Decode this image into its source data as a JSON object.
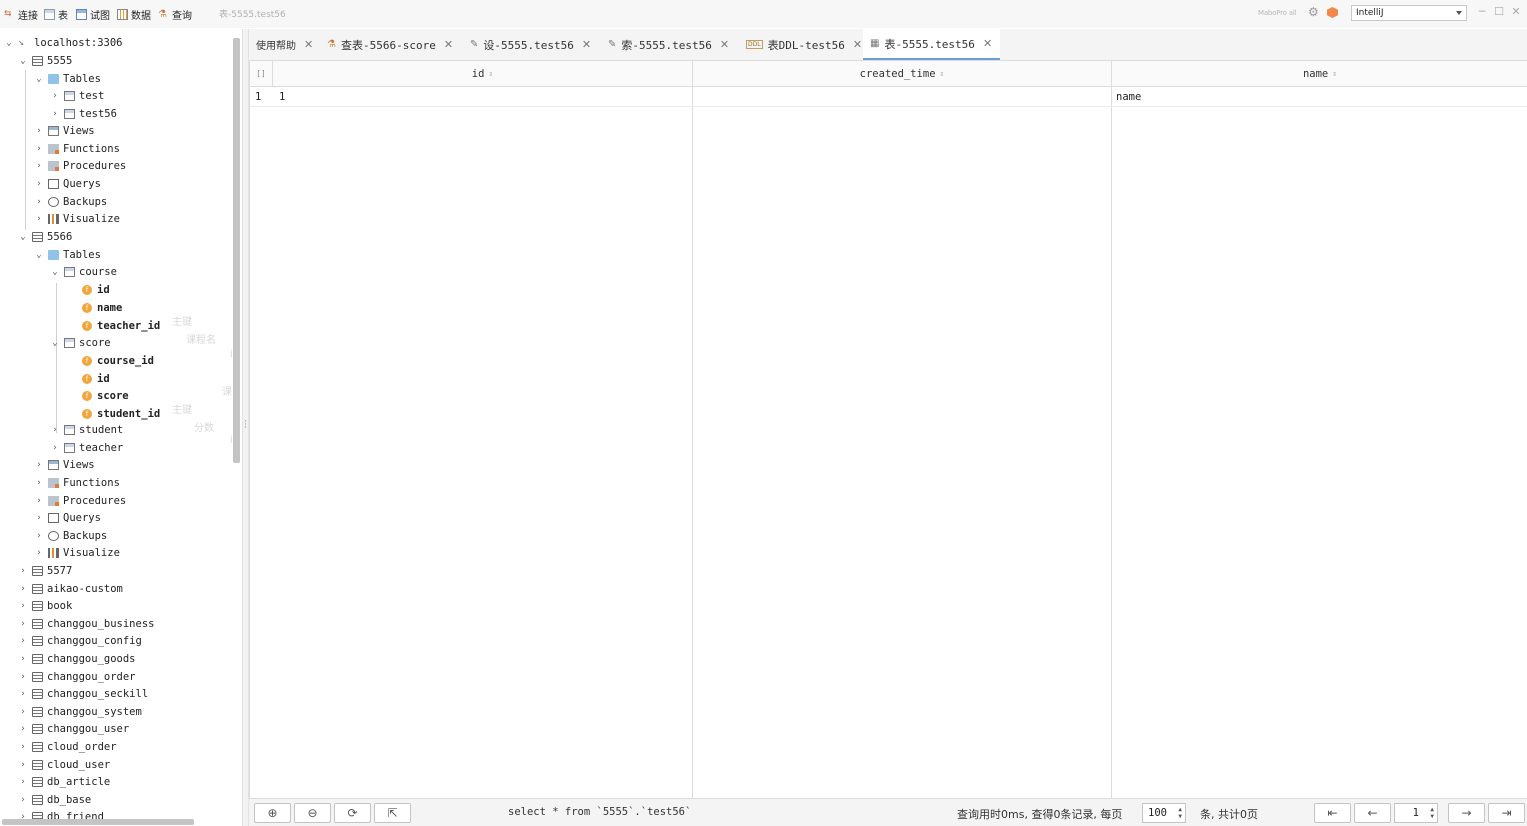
{
  "toolbar": {
    "connect": "连接",
    "table": "表",
    "view": "试图",
    "data": "数据",
    "query": "查询",
    "breadcrumb": "表-5555.test56",
    "brand": "MaboPro all",
    "theme_value": "IntelliJ"
  },
  "tree": {
    "connection": "localhost:3306",
    "db_5555": {
      "name": "5555",
      "tables_label": "Tables",
      "tables": [
        "test",
        "test56"
      ],
      "views": "Views",
      "functions": "Functions",
      "procedures": "Procedures",
      "querys": "Querys",
      "backups": "Backups",
      "visualize": "Visualize"
    },
    "db_5566": {
      "name": "5566",
      "tables_label": "Tables",
      "course": {
        "name": "course",
        "fields": [
          {
            "name": "id",
            "comment": "主键"
          },
          {
            "name": "name",
            "comment": "课程名"
          },
          {
            "name": "teacher_id",
            "comment": "i"
          }
        ]
      },
      "score": {
        "name": "score",
        "fields": [
          {
            "name": "course_id",
            "comment": "课"
          },
          {
            "name": "id",
            "comment": "主键"
          },
          {
            "name": "score",
            "comment": "分数"
          },
          {
            "name": "student_id",
            "comment": "i"
          }
        ]
      },
      "student": "student",
      "teacher": "teacher",
      "views": "Views",
      "functions": "Functions",
      "procedures": "Procedures",
      "querys": "Querys",
      "backups": "Backups",
      "visualize": "Visualize"
    },
    "other_dbs": [
      "5577",
      "aikao-custom",
      "book",
      "changgou_business",
      "changgou_config",
      "changgou_goods",
      "changgou_order",
      "changgou_seckill",
      "changgou_system",
      "changgou_user",
      "cloud_order",
      "cloud_user",
      "db_article",
      "db_base",
      "db_friend"
    ]
  },
  "tabs": [
    {
      "label": "使用帮助",
      "icon": "none"
    },
    {
      "label": "查表-5566-score",
      "icon": "query-icon"
    },
    {
      "label": "设-5555.test56",
      "icon": "pencil-icon"
    },
    {
      "label": "索-5555.test56",
      "icon": "pencil-icon"
    },
    {
      "label": "表DDL-test56",
      "icon": "ddl-icon"
    },
    {
      "label": "表-5555.test56",
      "icon": "table-icon"
    }
  ],
  "grid": {
    "corner": "[]",
    "columns": [
      "id",
      "created_time",
      "name"
    ],
    "rows": [
      {
        "index": "1",
        "id": "1",
        "created_time": "",
        "name": "name"
      }
    ]
  },
  "bottom": {
    "sql": "select * from `5555`.`test56`",
    "stats": "查询用时0ms, 查得0条记录, 每页",
    "page_size": "100",
    "unit": "条, 共计0页",
    "page": "1"
  }
}
